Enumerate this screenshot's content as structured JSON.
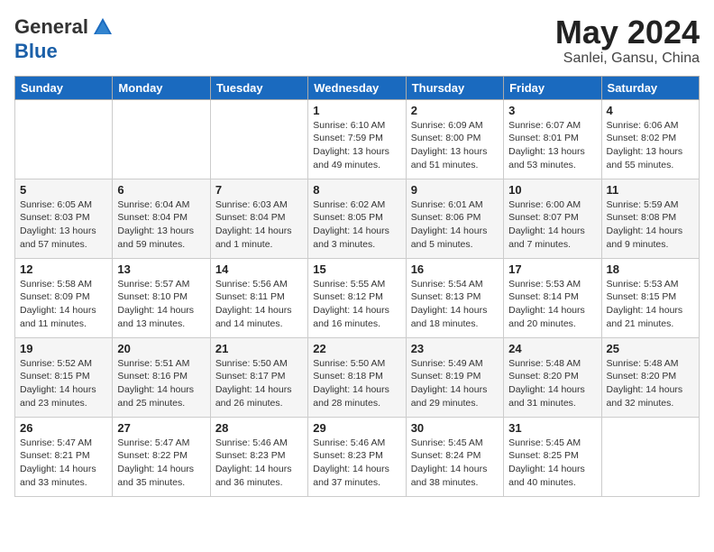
{
  "header": {
    "logo_general": "General",
    "logo_blue": "Blue",
    "month_year": "May 2024",
    "location": "Sanlei, Gansu, China"
  },
  "days_of_week": [
    "Sunday",
    "Monday",
    "Tuesday",
    "Wednesday",
    "Thursday",
    "Friday",
    "Saturday"
  ],
  "weeks": [
    [
      {
        "day": "",
        "info": ""
      },
      {
        "day": "",
        "info": ""
      },
      {
        "day": "",
        "info": ""
      },
      {
        "day": "1",
        "info": "Sunrise: 6:10 AM\nSunset: 7:59 PM\nDaylight: 13 hours\nand 49 minutes."
      },
      {
        "day": "2",
        "info": "Sunrise: 6:09 AM\nSunset: 8:00 PM\nDaylight: 13 hours\nand 51 minutes."
      },
      {
        "day": "3",
        "info": "Sunrise: 6:07 AM\nSunset: 8:01 PM\nDaylight: 13 hours\nand 53 minutes."
      },
      {
        "day": "4",
        "info": "Sunrise: 6:06 AM\nSunset: 8:02 PM\nDaylight: 13 hours\nand 55 minutes."
      }
    ],
    [
      {
        "day": "5",
        "info": "Sunrise: 6:05 AM\nSunset: 8:03 PM\nDaylight: 13 hours\nand 57 minutes."
      },
      {
        "day": "6",
        "info": "Sunrise: 6:04 AM\nSunset: 8:04 PM\nDaylight: 13 hours\nand 59 minutes."
      },
      {
        "day": "7",
        "info": "Sunrise: 6:03 AM\nSunset: 8:04 PM\nDaylight: 14 hours\nand 1 minute."
      },
      {
        "day": "8",
        "info": "Sunrise: 6:02 AM\nSunset: 8:05 PM\nDaylight: 14 hours\nand 3 minutes."
      },
      {
        "day": "9",
        "info": "Sunrise: 6:01 AM\nSunset: 8:06 PM\nDaylight: 14 hours\nand 5 minutes."
      },
      {
        "day": "10",
        "info": "Sunrise: 6:00 AM\nSunset: 8:07 PM\nDaylight: 14 hours\nand 7 minutes."
      },
      {
        "day": "11",
        "info": "Sunrise: 5:59 AM\nSunset: 8:08 PM\nDaylight: 14 hours\nand 9 minutes."
      }
    ],
    [
      {
        "day": "12",
        "info": "Sunrise: 5:58 AM\nSunset: 8:09 PM\nDaylight: 14 hours\nand 11 minutes."
      },
      {
        "day": "13",
        "info": "Sunrise: 5:57 AM\nSunset: 8:10 PM\nDaylight: 14 hours\nand 13 minutes."
      },
      {
        "day": "14",
        "info": "Sunrise: 5:56 AM\nSunset: 8:11 PM\nDaylight: 14 hours\nand 14 minutes."
      },
      {
        "day": "15",
        "info": "Sunrise: 5:55 AM\nSunset: 8:12 PM\nDaylight: 14 hours\nand 16 minutes."
      },
      {
        "day": "16",
        "info": "Sunrise: 5:54 AM\nSunset: 8:13 PM\nDaylight: 14 hours\nand 18 minutes."
      },
      {
        "day": "17",
        "info": "Sunrise: 5:53 AM\nSunset: 8:14 PM\nDaylight: 14 hours\nand 20 minutes."
      },
      {
        "day": "18",
        "info": "Sunrise: 5:53 AM\nSunset: 8:15 PM\nDaylight: 14 hours\nand 21 minutes."
      }
    ],
    [
      {
        "day": "19",
        "info": "Sunrise: 5:52 AM\nSunset: 8:15 PM\nDaylight: 14 hours\nand 23 minutes."
      },
      {
        "day": "20",
        "info": "Sunrise: 5:51 AM\nSunset: 8:16 PM\nDaylight: 14 hours\nand 25 minutes."
      },
      {
        "day": "21",
        "info": "Sunrise: 5:50 AM\nSunset: 8:17 PM\nDaylight: 14 hours\nand 26 minutes."
      },
      {
        "day": "22",
        "info": "Sunrise: 5:50 AM\nSunset: 8:18 PM\nDaylight: 14 hours\nand 28 minutes."
      },
      {
        "day": "23",
        "info": "Sunrise: 5:49 AM\nSunset: 8:19 PM\nDaylight: 14 hours\nand 29 minutes."
      },
      {
        "day": "24",
        "info": "Sunrise: 5:48 AM\nSunset: 8:20 PM\nDaylight: 14 hours\nand 31 minutes."
      },
      {
        "day": "25",
        "info": "Sunrise: 5:48 AM\nSunset: 8:20 PM\nDaylight: 14 hours\nand 32 minutes."
      }
    ],
    [
      {
        "day": "26",
        "info": "Sunrise: 5:47 AM\nSunset: 8:21 PM\nDaylight: 14 hours\nand 33 minutes."
      },
      {
        "day": "27",
        "info": "Sunrise: 5:47 AM\nSunset: 8:22 PM\nDaylight: 14 hours\nand 35 minutes."
      },
      {
        "day": "28",
        "info": "Sunrise: 5:46 AM\nSunset: 8:23 PM\nDaylight: 14 hours\nand 36 minutes."
      },
      {
        "day": "29",
        "info": "Sunrise: 5:46 AM\nSunset: 8:23 PM\nDaylight: 14 hours\nand 37 minutes."
      },
      {
        "day": "30",
        "info": "Sunrise: 5:45 AM\nSunset: 8:24 PM\nDaylight: 14 hours\nand 38 minutes."
      },
      {
        "day": "31",
        "info": "Sunrise: 5:45 AM\nSunset: 8:25 PM\nDaylight: 14 hours\nand 40 minutes."
      },
      {
        "day": "",
        "info": ""
      }
    ]
  ]
}
